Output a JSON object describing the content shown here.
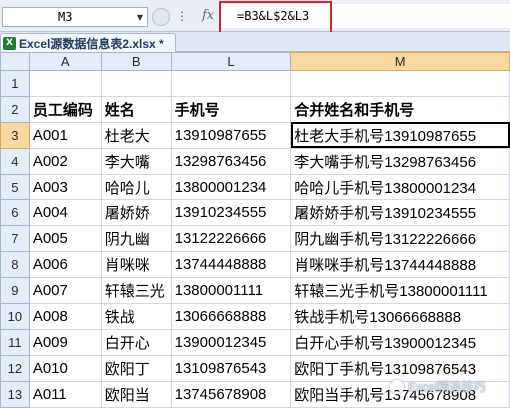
{
  "formula_bar": {
    "name_box": "M3",
    "fx_label": "fx",
    "formula": "=B3&L$2&L3"
  },
  "file_tab": {
    "icon_label": "X",
    "label": "Excel源数据信息表2.xlsx *"
  },
  "columns": [
    "A",
    "B",
    "L",
    "M"
  ],
  "rows": [
    {
      "num": "1",
      "cells": [
        "",
        "",
        "",
        ""
      ]
    },
    {
      "num": "2",
      "cells": [
        "员工编码",
        "姓名",
        "手机号",
        "合并姓名和手机号"
      ]
    },
    {
      "num": "3",
      "cells": [
        "A001",
        "杜老大",
        "13910987655",
        "杜老大手机号13910987655"
      ]
    },
    {
      "num": "4",
      "cells": [
        "A002",
        "李大嘴",
        "13298763456",
        "李大嘴手机号13298763456"
      ]
    },
    {
      "num": "5",
      "cells": [
        "A003",
        "哈哈儿",
        "13800001234",
        "哈哈儿手机号13800001234"
      ]
    },
    {
      "num": "6",
      "cells": [
        "A004",
        "屠娇娇",
        "13910234555",
        "屠娇娇手机号13910234555"
      ]
    },
    {
      "num": "7",
      "cells": [
        "A005",
        "阴九幽",
        "13122226666",
        "阴九幽手机号13122226666"
      ]
    },
    {
      "num": "8",
      "cells": [
        "A006",
        "肖咪咪",
        "13744448888",
        "肖咪咪手机号13744448888"
      ]
    },
    {
      "num": "9",
      "cells": [
        "A007",
        "轩辕三光",
        "13800001111",
        "轩辕三光手机号13800001111"
      ]
    },
    {
      "num": "10",
      "cells": [
        "A008",
        "铁战",
        "13066668888",
        "铁战手机号13066668888"
      ]
    },
    {
      "num": "11",
      "cells": [
        "A009",
        "白开心",
        "13900012345",
        "白开心手机号13900012345"
      ]
    },
    {
      "num": "12",
      "cells": [
        "A010",
        "欧阳丁",
        "13109876543",
        "欧阳丁手机号13109876543"
      ]
    },
    {
      "num": "13",
      "cells": [
        "A011",
        "欧阳当",
        "13745678908",
        "欧阳当手机号13745678908"
      ]
    }
  ],
  "watermark": "Excel精选技巧"
}
